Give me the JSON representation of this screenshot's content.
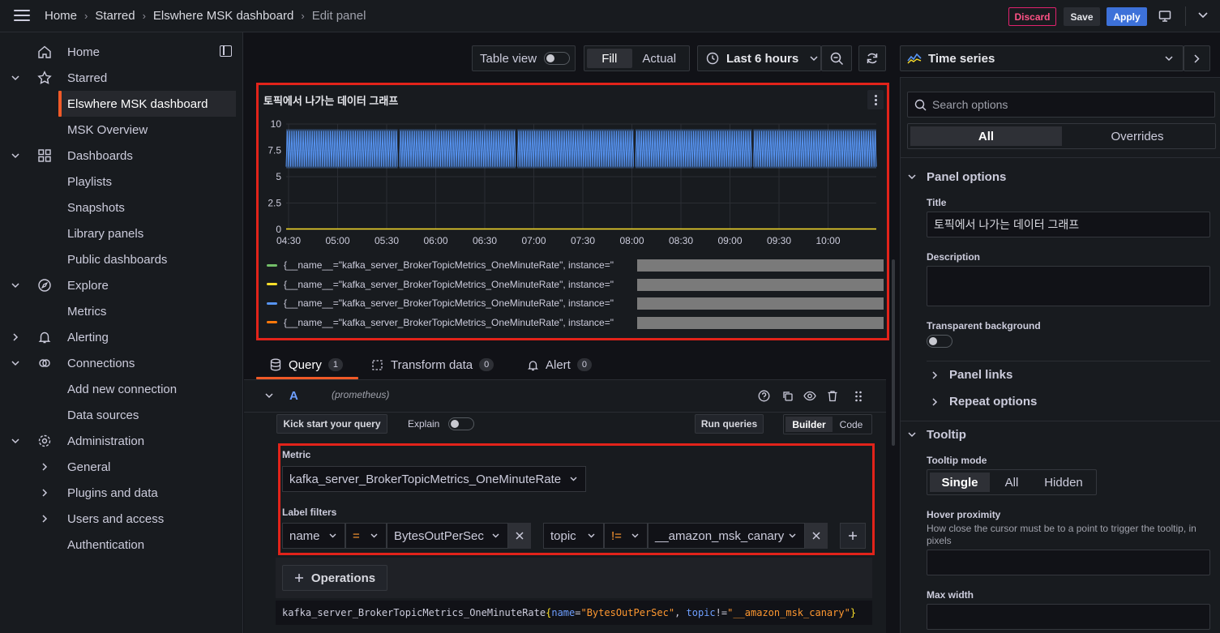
{
  "breadcrumb": {
    "home": "Home",
    "starred": "Starred",
    "dashboard": "Elswhere MSK dashboard",
    "current": "Edit panel"
  },
  "topbar": {
    "discard": "Discard",
    "save": "Save",
    "apply": "Apply"
  },
  "sidebar": {
    "items": [
      {
        "label": "Home",
        "icon": "home-icon"
      },
      {
        "label": "Starred",
        "icon": "star-icon"
      },
      {
        "label": "Elswhere MSK dashboard"
      },
      {
        "label": "MSK Overview"
      },
      {
        "label": "Dashboards",
        "icon": "apps-icon"
      },
      {
        "label": "Playlists"
      },
      {
        "label": "Snapshots"
      },
      {
        "label": "Library panels"
      },
      {
        "label": "Public dashboards"
      },
      {
        "label": "Explore",
        "icon": "compass-icon"
      },
      {
        "label": "Metrics"
      },
      {
        "label": "Alerting",
        "icon": "bell-icon"
      },
      {
        "label": "Connections",
        "icon": "link-icon"
      },
      {
        "label": "Add new connection"
      },
      {
        "label": "Data sources"
      },
      {
        "label": "Administration",
        "icon": "cog-icon"
      },
      {
        "label": "General"
      },
      {
        "label": "Plugins and data"
      },
      {
        "label": "Users and access"
      },
      {
        "label": "Authentication"
      }
    ]
  },
  "toolbar": {
    "table_view": "Table view",
    "fill": "Fill",
    "actual": "Actual",
    "time_range": "Last 6 hours"
  },
  "panel": {
    "title": "토픽에서 나가는 데이터 그래프",
    "legend": [
      {
        "label": "{__name__=\"kafka_server_BrokerTopicMetrics_OneMinuteRate\", instance=\"",
        "color": "#73bf69"
      },
      {
        "label": "{__name__=\"kafka_server_BrokerTopicMetrics_OneMinuteRate\", instance=\"",
        "color": "#fade2a"
      },
      {
        "label": "{__name__=\"kafka_server_BrokerTopicMetrics_OneMinuteRate\", instance=\"",
        "color": "#5794f2"
      },
      {
        "label": "{__name__=\"kafka_server_BrokerTopicMetrics_OneMinuteRate\", instance=\"",
        "color": "#ff780a"
      }
    ]
  },
  "chart_data": {
    "type": "line",
    "x_ticks": [
      "04:30",
      "05:00",
      "05:30",
      "06:00",
      "06:30",
      "07:00",
      "07:30",
      "08:00",
      "08:30",
      "09:00",
      "09:30",
      "10:00"
    ],
    "y_ticks": [
      "0",
      "2.5",
      "5",
      "7.5",
      "10"
    ],
    "ylim": [
      0,
      10
    ],
    "series": [
      {
        "name": "{__name__=\"kafka_server_BrokerTopicMetrics_OneMinuteRate\", instance=\"",
        "color": "#5794f2",
        "band": [
          5.8,
          9.5
        ]
      },
      {
        "name": "{__name__=\"kafka_server_BrokerTopicMetrics_OneMinuteRate\", instance=\"",
        "color": "#fade2a",
        "values": [
          0,
          0
        ]
      }
    ]
  },
  "tabs": {
    "query": "Query",
    "query_count": "1",
    "transform": "Transform data",
    "transform_count": "0",
    "alert": "Alert",
    "alert_count": "0"
  },
  "query": {
    "letter": "A",
    "datasource": "(prometheus)",
    "kick_start": "Kick start your query",
    "explain": "Explain",
    "run": "Run queries",
    "builder": "Builder",
    "code": "Code",
    "metric_label": "Metric",
    "metric": "kafka_server_BrokerTopicMetrics_OneMinuteRate",
    "label_filters": "Label filters",
    "f1_label": "name",
    "f1_op": "=",
    "f1_value": "BytesOutPerSec",
    "f2_label": "topic",
    "f2_op": "!=",
    "f2_value": "__amazon_msk_canary",
    "operations": "Operations",
    "preview": {
      "metric": "kafka_server_BrokerTopicMetrics_OneMinuteRate",
      "open": "{",
      "k1": "name",
      "eq": "=",
      "v1": "\"BytesOutPerSec\"",
      "comma": ", ",
      "k2": "topic",
      "neq": "!=",
      "v2": "\"__amazon_msk_canary\"",
      "close": "}"
    }
  },
  "options": {
    "viz": "Time series",
    "search_placeholder": "Search options",
    "all": "All",
    "overrides": "Overrides",
    "panel_options": "Panel options",
    "title_label": "Title",
    "title_value": "토픽에서 나가는 데이터 그래프",
    "description_label": "Description",
    "transparent": "Transparent background",
    "panel_links": "Panel links",
    "repeat": "Repeat options",
    "tooltip": "Tooltip",
    "tooltip_mode": "Tooltip mode",
    "single": "Single",
    "mode_all": "All",
    "hidden": "Hidden",
    "hover": "Hover proximity",
    "hover_desc": "How close the cursor must be to a point to trigger the tooltip, in pixels",
    "max_width": "Max width"
  }
}
